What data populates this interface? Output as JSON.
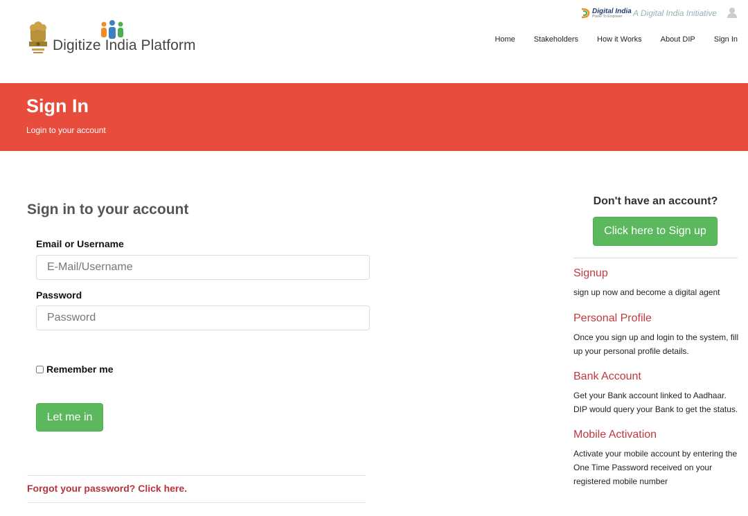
{
  "header": {
    "logo_text": "Digitize India Platform",
    "digital_india": {
      "name": "Digital India",
      "slogan": "Power To Empower",
      "tagline": "A Digital India Initiative"
    },
    "nav": [
      {
        "label": "Home"
      },
      {
        "label": "Stakeholders"
      },
      {
        "label": "How it Works"
      },
      {
        "label": "About DIP"
      },
      {
        "label": "Sign In"
      }
    ]
  },
  "banner": {
    "title": "Sign In",
    "subtitle": "Login to your account",
    "color": "#e84c3d"
  },
  "form": {
    "heading": "Sign in to your account",
    "email_label": "Email or Username",
    "email_placeholder": "E-Mail/Username",
    "email_value": "",
    "password_label": "Password",
    "password_placeholder": "Password",
    "password_value": "",
    "remember_label": "Remember me",
    "remember_checked": false,
    "submit_label": "Let me in",
    "forgot_link": "Forgot your password? Click here."
  },
  "sidebar": {
    "question": "Don't have an account?",
    "signup_button": "Click here to Sign up",
    "sections": [
      {
        "title": "Signup",
        "text": "sign up now and become a digital agent"
      },
      {
        "title": "Personal Profile",
        "text": "Once you sign up and login to the system, fill up your personal profile details."
      },
      {
        "title": "Bank Account",
        "text": "Get your Bank account linked to Aadhaar. DIP would query your Bank to get the status."
      },
      {
        "title": "Mobile Activation",
        "text": "Activate your mobile account by entering the One Time Password received on your registered mobile number"
      }
    ]
  },
  "colors": {
    "accent_green": "#5cb85c",
    "link_red": "#b8323c",
    "banner_red": "#e84c3d"
  }
}
